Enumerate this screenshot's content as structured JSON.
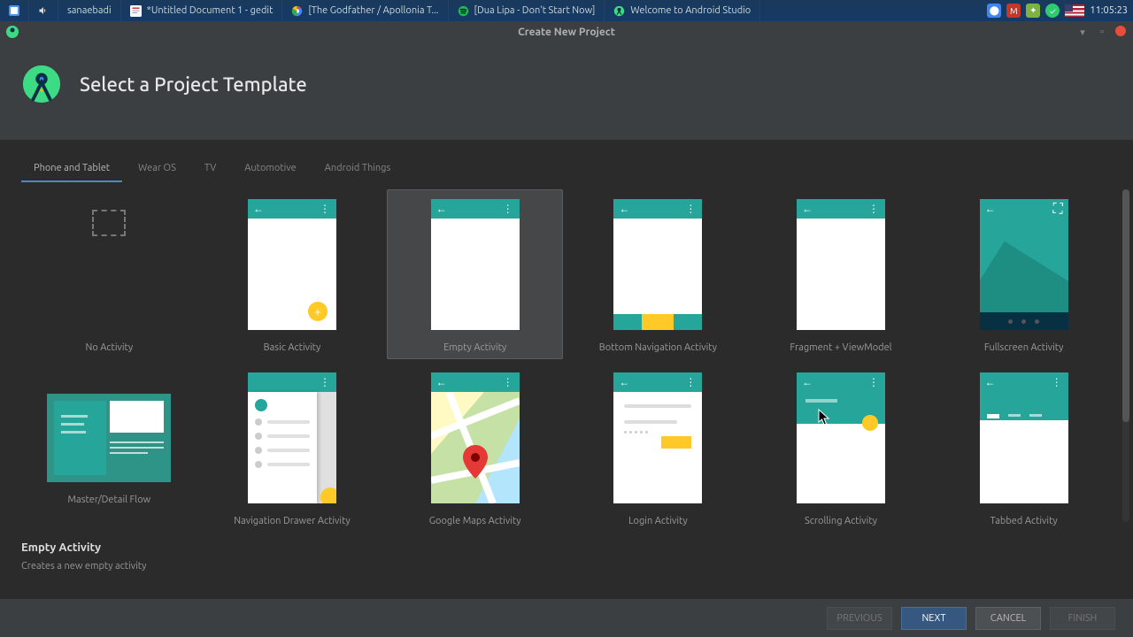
{
  "taskbar": {
    "user": "sanaebadi",
    "tasks": [
      {
        "label": "*Untitled Document 1 - gedit",
        "icon": "gedit"
      },
      {
        "label": "[The Godfather / Apollonia T...",
        "icon": "chrome"
      },
      {
        "label": "[Dua Lipa - Don't Start Now]",
        "icon": "spotify"
      },
      {
        "label": "Welcome to Android Studio",
        "icon": "android-studio"
      }
    ],
    "clock": "11:05:23"
  },
  "window": {
    "title": "Create New Project"
  },
  "header": {
    "title": "Select a Project Template"
  },
  "tabs": [
    {
      "label": "Phone and Tablet",
      "active": true
    },
    {
      "label": "Wear OS",
      "active": false
    },
    {
      "label": "TV",
      "active": false
    },
    {
      "label": "Automotive",
      "active": false
    },
    {
      "label": "Android Things",
      "active": false
    }
  ],
  "templates": [
    {
      "label": "No Activity",
      "kind": "none"
    },
    {
      "label": "Basic Activity",
      "kind": "basic"
    },
    {
      "label": "Empty Activity",
      "kind": "empty",
      "selected": true
    },
    {
      "label": "Bottom Navigation Activity",
      "kind": "bottomnav"
    },
    {
      "label": "Fragment + ViewModel",
      "kind": "fragment"
    },
    {
      "label": "Fullscreen Activity",
      "kind": "fullscreen"
    },
    {
      "label": "Master/Detail Flow",
      "kind": "master"
    },
    {
      "label": "Navigation Drawer Activity",
      "kind": "navdrawer"
    },
    {
      "label": "Google Maps Activity",
      "kind": "map"
    },
    {
      "label": "Login Activity",
      "kind": "login"
    },
    {
      "label": "Scrolling Activity",
      "kind": "scroll"
    },
    {
      "label": "Tabbed Activity",
      "kind": "tabbed"
    }
  ],
  "selection": {
    "title": "Empty Activity",
    "description": "Creates a new empty activity"
  },
  "footer": {
    "previous": "PREVIOUS",
    "next": "NEXT",
    "cancel": "CANCEL",
    "finish": "FINISH"
  }
}
